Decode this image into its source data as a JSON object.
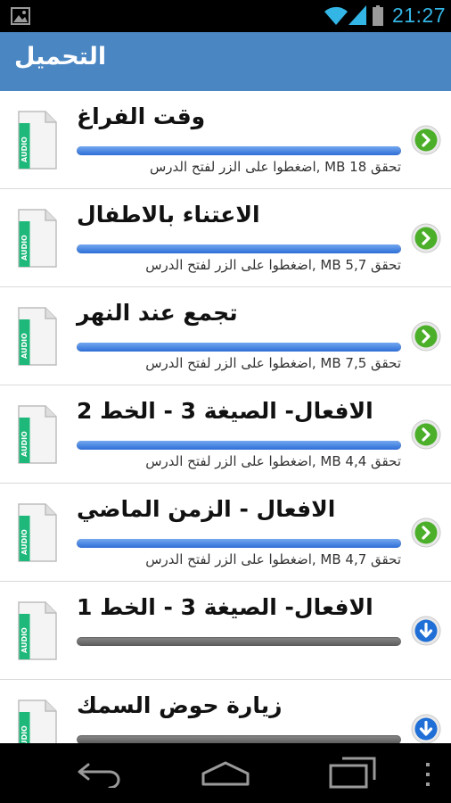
{
  "status_bar": {
    "time": "21:27",
    "icons": [
      "gallery-icon",
      "wifi-icon",
      "signal-icon",
      "battery-icon"
    ],
    "accent_color": "#33b5e5"
  },
  "action_bar": {
    "title": "التحميل",
    "background_color": "#4a86c2"
  },
  "lessons": [
    {
      "title": "وقت الفراغ",
      "subtitle": "تحقق MB 18 ,اضغطوا على الزر لفتح الدرس",
      "progress": 1.0,
      "status": "downloaded",
      "action_icon": "play-arrow-icon",
      "file_icon_text": "AUDIO"
    },
    {
      "title": "الاعتناء بالاطفال",
      "subtitle": "تحقق MB 5,7 ,اضغطوا على الزر لفتح الدرس",
      "progress": 1.0,
      "status": "downloaded",
      "action_icon": "play-arrow-icon",
      "file_icon_text": "AUDIO"
    },
    {
      "title": "تجمع عند النهر",
      "subtitle": "تحقق MB 7,5 ,اضغطوا على الزر لفتح الدرس",
      "progress": 1.0,
      "status": "downloaded",
      "action_icon": "play-arrow-icon",
      "file_icon_text": "AUDIO"
    },
    {
      "title": "الافعال- الصيغة 3 - الخط 2",
      "subtitle": "تحقق MB 4,4 ,اضغطوا على الزر لفتح الدرس",
      "progress": 1.0,
      "status": "downloaded",
      "action_icon": "play-arrow-icon",
      "file_icon_text": "AUDIO"
    },
    {
      "title": "الافعال - الزمن الماضي",
      "subtitle": "تحقق MB 4,7 ,اضغطوا على الزر لفتح الدرس",
      "progress": 1.0,
      "status": "downloaded",
      "action_icon": "play-arrow-icon",
      "file_icon_text": "AUDIO"
    },
    {
      "title": "الافعال- الصيغة 3 - الخط 1",
      "subtitle": "",
      "progress": 0.0,
      "status": "not-downloaded",
      "action_icon": "download-arrow-icon",
      "file_icon_text": "AUDIO"
    },
    {
      "title": "زيارة  حوض السمك",
      "subtitle": "",
      "progress": 0.0,
      "status": "not-downloaded",
      "action_icon": "download-arrow-icon",
      "file_icon_text": "AUDIO"
    }
  ],
  "colors": {
    "progress_fill": "#2d6dd6",
    "progress_track": "#6e6e6e",
    "play_button": "#4caf2a",
    "download_button": "#1f6fd6"
  },
  "nav_bar": {
    "icons": [
      "back-icon",
      "home-icon",
      "recent-apps-icon",
      "overflow-menu-icon"
    ]
  }
}
